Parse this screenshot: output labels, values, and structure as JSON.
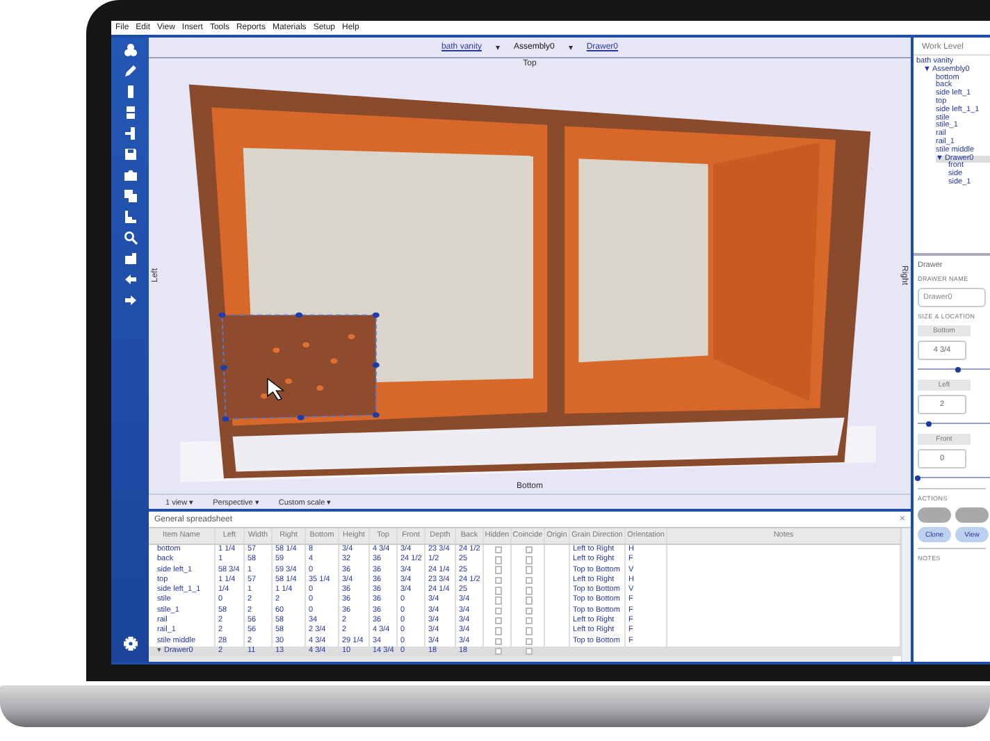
{
  "menu": [
    "File",
    "Edit",
    "View",
    "Insert",
    "Tools",
    "Reports",
    "Materials",
    "Setup",
    "Help"
  ],
  "viewport": {
    "breadcrumb": [
      {
        "label": "bath vanity",
        "current": false,
        "caret": "▾"
      },
      {
        "label": "Assembly0",
        "current": true,
        "caret": "▾"
      },
      {
        "label": "Drawer0",
        "current": false
      }
    ],
    "top_label": "Top",
    "left_label": "Left",
    "right_label": "Right",
    "bottom_label": "Bottom",
    "status": [
      "1 view ▾",
      "Perspective ▾",
      "Custom scale ▾"
    ]
  },
  "spreadsheet": {
    "title": "General spreadsheet",
    "close": "×",
    "columns": [
      "Item Name",
      "Left",
      "Width",
      "Right",
      "Bottom",
      "Height",
      "Top",
      "Front",
      "Depth",
      "Back",
      "Hidden",
      "Coincide",
      "Origin",
      "Grain Direction",
      "Orientation",
      "Notes"
    ],
    "rows": [
      {
        "name": "bottom",
        "values": [
          "1 1/4",
          "57",
          "58 1/4",
          "8",
          "3/4",
          "4 3/4",
          "3/4",
          "23 3/4",
          "24 1/2"
        ],
        "hidden": false,
        "coincide": false,
        "grain": "Left to Right",
        "orientation": "H",
        "selected": false
      },
      {
        "name": "back",
        "values": [
          "1",
          "58",
          "59",
          "4",
          "32",
          "36",
          "24 1/2",
          "1/2",
          "25"
        ],
        "hidden": false,
        "coincide": false,
        "grain": "Left to Right",
        "orientation": "F",
        "selected": false
      },
      {
        "name": "side left_1",
        "values": [
          "58 3/4",
          "1",
          "59 3/4",
          "0",
          "36",
          "36",
          "3/4",
          "24 1/4",
          "25"
        ],
        "hidden": false,
        "coincide": false,
        "grain": "Top to Bottom",
        "orientation": "V",
        "selected": false
      },
      {
        "name": "top",
        "values": [
          "1 1/4",
          "57",
          "58 1/4",
          "35 1/4",
          "3/4",
          "36",
          "3/4",
          "23 3/4",
          "24 1/2"
        ],
        "hidden": false,
        "coincide": false,
        "grain": "Left to Right",
        "orientation": "H",
        "selected": false
      },
      {
        "name": "side left_1_1",
        "values": [
          "1/4",
          "1",
          "1 1/4",
          "0",
          "36",
          "36",
          "3/4",
          "24 1/4",
          "25"
        ],
        "hidden": false,
        "coincide": false,
        "grain": "Top to Bottom",
        "orientation": "V",
        "selected": false
      },
      {
        "name": "stile",
        "values": [
          "0",
          "2",
          "2",
          "0",
          "36",
          "36",
          "0",
          "3/4",
          "3/4"
        ],
        "hidden": false,
        "coincide": false,
        "grain": "Top to Bottom",
        "orientation": "F",
        "selected": false
      },
      {
        "name": "stile_1",
        "values": [
          "58",
          "2",
          "60",
          "0",
          "36",
          "36",
          "0",
          "3/4",
          "3/4"
        ],
        "hidden": false,
        "coincide": false,
        "grain": "Top to Bottom",
        "orientation": "F",
        "selected": false
      },
      {
        "name": "rail",
        "values": [
          "2",
          "56",
          "58",
          "34",
          "2",
          "36",
          "0",
          "3/4",
          "3/4"
        ],
        "hidden": false,
        "coincide": false,
        "grain": "Left to Right",
        "orientation": "F",
        "selected": false
      },
      {
        "name": "rail_1",
        "values": [
          "2",
          "56",
          "58",
          "2 3/4",
          "2",
          "4 3/4",
          "0",
          "3/4",
          "3/4"
        ],
        "hidden": false,
        "coincide": false,
        "grain": "Left to Right",
        "orientation": "F",
        "selected": false
      },
      {
        "name": "stile middle",
        "values": [
          "28",
          "2",
          "30",
          "4 3/4",
          "29 1/4",
          "34",
          "0",
          "3/4",
          "3/4"
        ],
        "hidden": false,
        "coincide": false,
        "grain": "Top to Bottom",
        "orientation": "F",
        "selected": false
      },
      {
        "name": "Drawer0",
        "toggle": "▾",
        "values": [
          "2",
          "11",
          "13",
          "4 3/4",
          "10",
          "14 3/4",
          "0",
          "18",
          "18"
        ],
        "hidden": false,
        "coincide": false,
        "selected": true
      }
    ]
  },
  "work_level": {
    "title": "Work Level",
    "tree": [
      {
        "label": "bath vanity",
        "selected": false,
        "children": [
          {
            "label": "Assembly0",
            "toggle": "▼",
            "selected": false,
            "children": [
              {
                "label": "bottom",
                "selected": false
              },
              {
                "label": "back",
                "selected": false
              },
              {
                "label": "side left_1",
                "selected": false
              },
              {
                "label": "top",
                "selected": false
              },
              {
                "label": "side left_1_1",
                "selected": false
              },
              {
                "label": "stile",
                "selected": false
              },
              {
                "label": "stile_1",
                "selected": false
              },
              {
                "label": "rail",
                "selected": false
              },
              {
                "label": "rail_1",
                "selected": false
              },
              {
                "label": "stile middle",
                "selected": false
              },
              {
                "label": "Drawer0",
                "toggle": "▼",
                "selected": true,
                "children": [
                  {
                    "label": "front",
                    "selected": false
                  },
                  {
                    "label": "side",
                    "selected": false
                  },
                  {
                    "label": "side_1",
                    "selected": false
                  }
                ]
              }
            ]
          }
        ]
      }
    ]
  },
  "properties": {
    "title": "Drawer",
    "name_label": "DRAWER NAME",
    "name_value": "Drawer0",
    "section": "SIZE & LOCATION",
    "fields": [
      {
        "label": "Bottom",
        "value": "4 3/4",
        "level": 0.55
      },
      {
        "label": "Left",
        "value": "2",
        "level": 0.15
      },
      {
        "label": "Front",
        "value": "0",
        "level": 0
      }
    ],
    "actions_label": "ACTIONS",
    "actions": [
      {
        "kind": "secondary"
      },
      {
        "kind": "secondary"
      },
      {
        "kind": "primary",
        "label": "Clone"
      },
      {
        "kind": "primary",
        "label": "View"
      }
    ],
    "notes_label": "NOTES"
  }
}
